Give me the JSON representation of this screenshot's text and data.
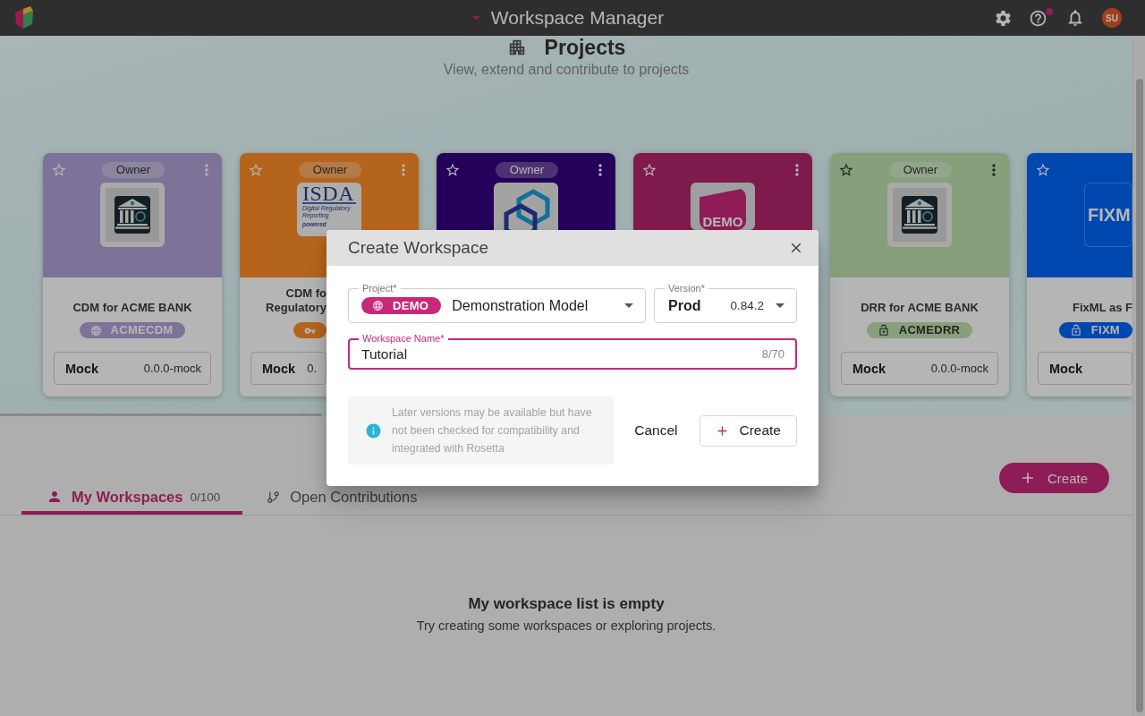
{
  "top_bar": {
    "title": "Workspace Manager",
    "help_badge": true,
    "avatar": "SU"
  },
  "header": {
    "title": "Projects",
    "subtitle": "View, extend and contribute to projects"
  },
  "projects": [
    {
      "starred": false,
      "role": "Owner",
      "menu_button": true,
      "color": "#7e7499",
      "logo": {
        "kind": "bank"
      },
      "title_lines": [
        "CDM for ACME BANK"
      ],
      "badge": {
        "kind": "public",
        "text": "ACMECDM"
      },
      "release": {
        "label": "Mock",
        "version": "0.0.0-mock"
      }
    },
    {
      "starred": false,
      "role": "Owner",
      "menu_button": true,
      "color": "#b5651c",
      "logo": {
        "kind": "isda",
        "title": "ISDA",
        "subtitle": "Digital Regulatory Reporting",
        "caption": "powered"
      },
      "title_lines": [
        "CDM fo",
        "Regulatory"
      ],
      "badge": {
        "kind": "key"
      },
      "release": {
        "label": "Mock",
        "version": "0."
      }
    },
    {
      "starred": false,
      "role": "Owner",
      "menu_button": true,
      "color": "#25005a",
      "logo": {
        "kind": "hexagons"
      }
    },
    {
      "starred": false,
      "menu_button": true,
      "color": "#801c4c",
      "logo": {
        "kind": "tag",
        "title": "DEMO"
      }
    },
    {
      "starred": false,
      "role": "Owner",
      "menu_button": true,
      "color": "#87a07a",
      "logo": {
        "kind": "bank"
      },
      "title_lines": [
        "DRR for ACME BANK"
      ],
      "badge": {
        "kind": "unlocked",
        "text": "ACMEDRR"
      },
      "release": {
        "label": "Mock",
        "version": "0.0.0-mock"
      }
    },
    {
      "starred": false,
      "menu_button": false,
      "color": "#0047b0",
      "logo": {
        "kind": "wordmark",
        "title": "FIXM"
      },
      "title_lines": [
        "FixML as F"
      ],
      "badge": {
        "kind": "unlocked",
        "text": "FIXM"
      },
      "release": {
        "label": "Mock"
      }
    }
  ],
  "tabs": [
    {
      "kind": "person",
      "label": "My Workspaces",
      "count": "0/100",
      "selected": true
    },
    {
      "kind": "branch",
      "label": "Open Contributions",
      "selected": false
    }
  ],
  "create_button": {
    "label": "Create"
  },
  "empty_state": {
    "title": "My workspace list is empty",
    "message": "Try creating some workspaces or exploring projects."
  },
  "dialog": {
    "title": "Create Workspace",
    "project": {
      "label": "Project*",
      "badge": {
        "kind": "public",
        "text": "DEMO"
      },
      "value": "Demonstration Model"
    },
    "version": {
      "label": "Version*",
      "value": "Prod",
      "number": "0.84.2"
    },
    "workspace_name": {
      "label": "Workspace Name*",
      "value": "Tutorial",
      "counter": "8/70",
      "focused": true
    },
    "info": "Later versions may be available but have not been checked for compatibility and integrated with Rosetta",
    "buttons": [
      {
        "kind": "plain",
        "label": "Cancel"
      },
      {
        "kind": "add",
        "label": "Create"
      }
    ]
  }
}
